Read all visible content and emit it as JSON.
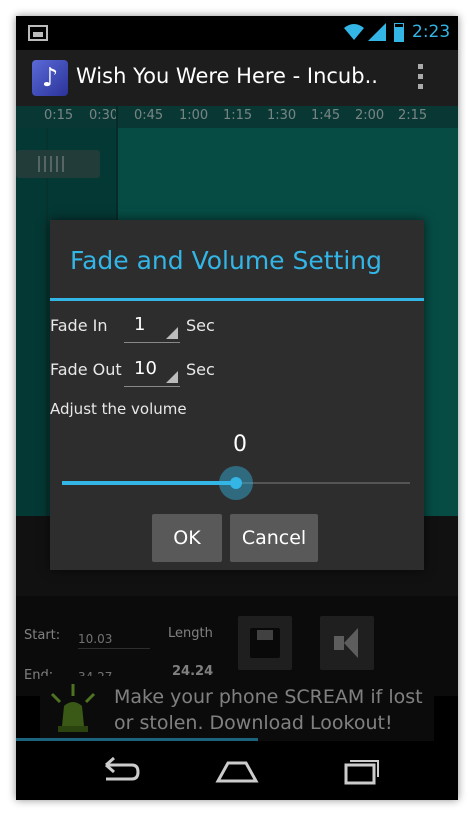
{
  "status_bar": {
    "time": "2:23"
  },
  "action_bar": {
    "title": "Wish You Were Here - Incub..."
  },
  "timeline": {
    "ticks": [
      "0:15",
      "0:30",
      "0:45",
      "1:00",
      "1:15",
      "1:30",
      "1:45",
      "2:00",
      "2:15"
    ]
  },
  "dialog": {
    "title": "Fade and Volume Setting",
    "fade_in_label": "Fade In",
    "fade_in_value": "1",
    "fade_out_label": "Fade Out",
    "fade_out_value": "10",
    "unit": "Sec",
    "volume_label": "Adjust the volume",
    "volume_value": "0",
    "volume_position": 0.5,
    "ok_label": "OK",
    "cancel_label": "Cancel"
  },
  "info": {
    "start_label": "Start:",
    "start_value": "10.03",
    "end_label": "End:",
    "end_value": "34.27",
    "length_label": "Length",
    "length_value": "24.24"
  },
  "ad": {
    "text": "Make your phone SCREAM if lost or stolen. Download Lookout!"
  },
  "colors": {
    "accent": "#33b5e5",
    "waveform": "#0c8a7f"
  }
}
